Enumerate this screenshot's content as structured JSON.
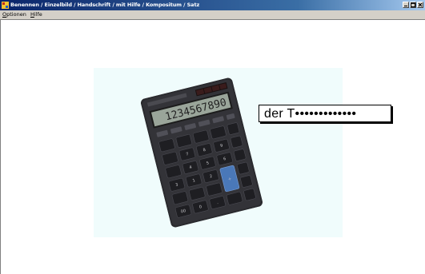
{
  "window": {
    "title": "Benennen / Einzelbild / Handschrift / mit Hilfe / Kompositum / Satz",
    "app_icon": "app-icon",
    "controls": [
      "minimize-icon",
      "maximize-icon",
      "close-icon"
    ]
  },
  "menu": {
    "items": [
      {
        "label": "Optionen",
        "accelerator": "O"
      },
      {
        "label": "Hilfe",
        "accelerator": "H"
      }
    ]
  },
  "exercise": {
    "image_subject": "calculator",
    "answer_text": "der T•••••••••••••"
  },
  "colors": {
    "titlebar_start": "#0a246a",
    "titlebar_end": "#a6caf0",
    "stage_background": "#f0fcfc",
    "calculator_body": "#2a2a2e",
    "calculator_display": "#9aa59a",
    "accent_key": "#4a78b8"
  }
}
